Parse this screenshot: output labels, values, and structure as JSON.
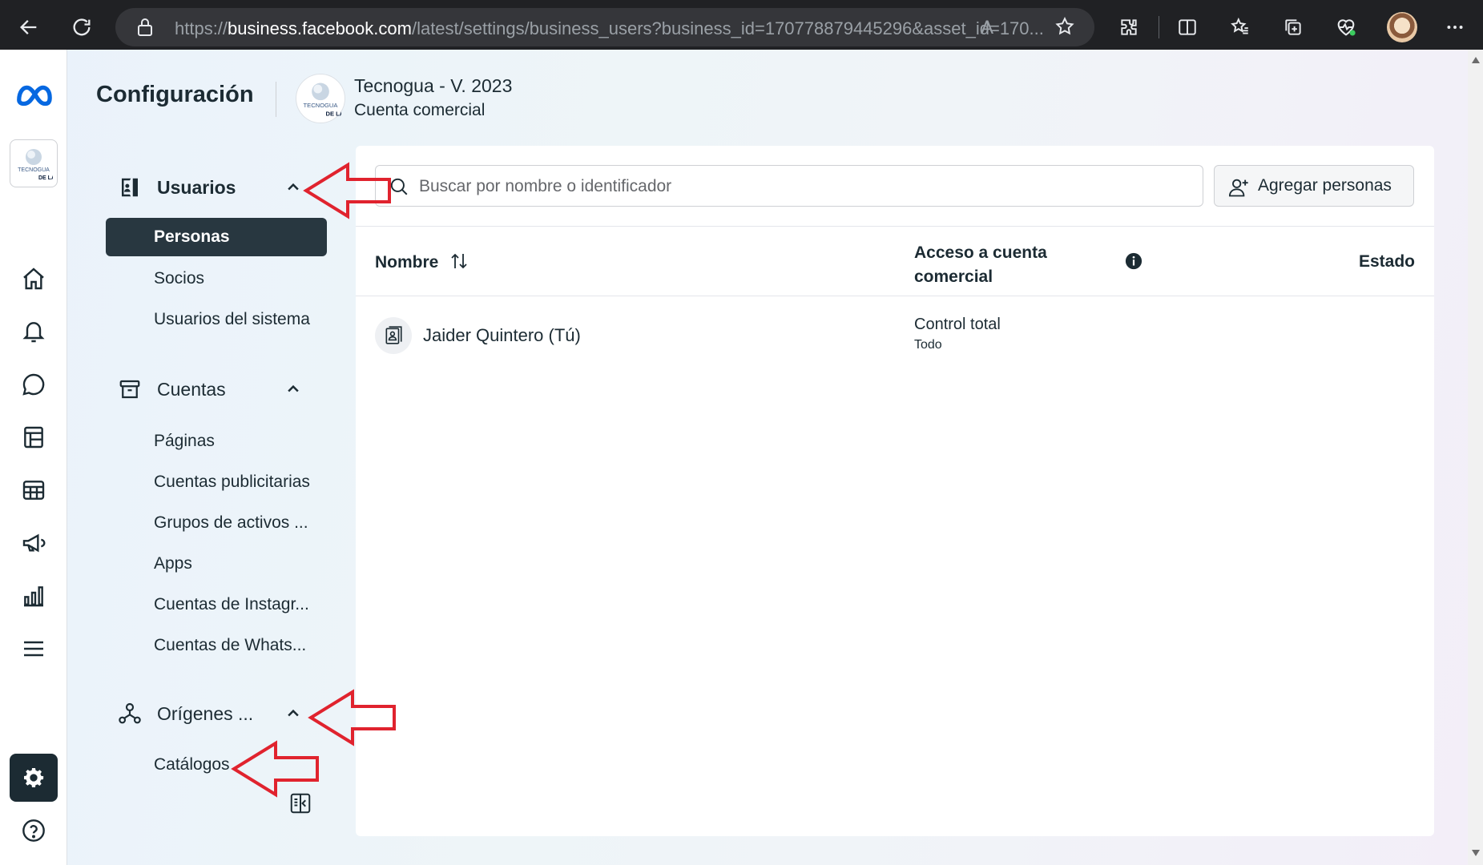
{
  "browser": {
    "url_prefix": "https://",
    "url_host": "business.facebook.com",
    "url_rest": "/latest/settings/business_users?business_id=170778879445296&asset_id=170..."
  },
  "header": {
    "title": "Configuración",
    "business_name": "Tecnogua - V. 2023",
    "business_type": "Cuenta comercial",
    "logo_text": "TECNOGUA"
  },
  "nav": {
    "users": {
      "label": "Usuarios",
      "items": [
        "Personas",
        "Socios",
        "Usuarios del sistema"
      ]
    },
    "accounts": {
      "label": "Cuentas",
      "items": [
        "Páginas",
        "Cuentas publicitarias",
        "Grupos de activos ...",
        "Apps",
        "Cuentas de Instagr...",
        "Cuentas de Whats..."
      ]
    },
    "sources": {
      "label": "Orígenes ...",
      "items": [
        "Catálogos"
      ]
    }
  },
  "main": {
    "search_placeholder": "Buscar por nombre o identificador",
    "add_button": "Agregar personas",
    "columns": {
      "name": "Nombre",
      "access": "Acceso a cuenta comercial",
      "status": "Estado"
    },
    "rows": [
      {
        "name": "Jaider Quintero (Tú)",
        "access": "Control total",
        "access_detail": "Todo"
      }
    ]
  },
  "colors": {
    "accent_dark": "#1c2b33",
    "active_bg": "#283740",
    "annotation_red": "#e0232e",
    "meta_blue": "#0668e1"
  }
}
